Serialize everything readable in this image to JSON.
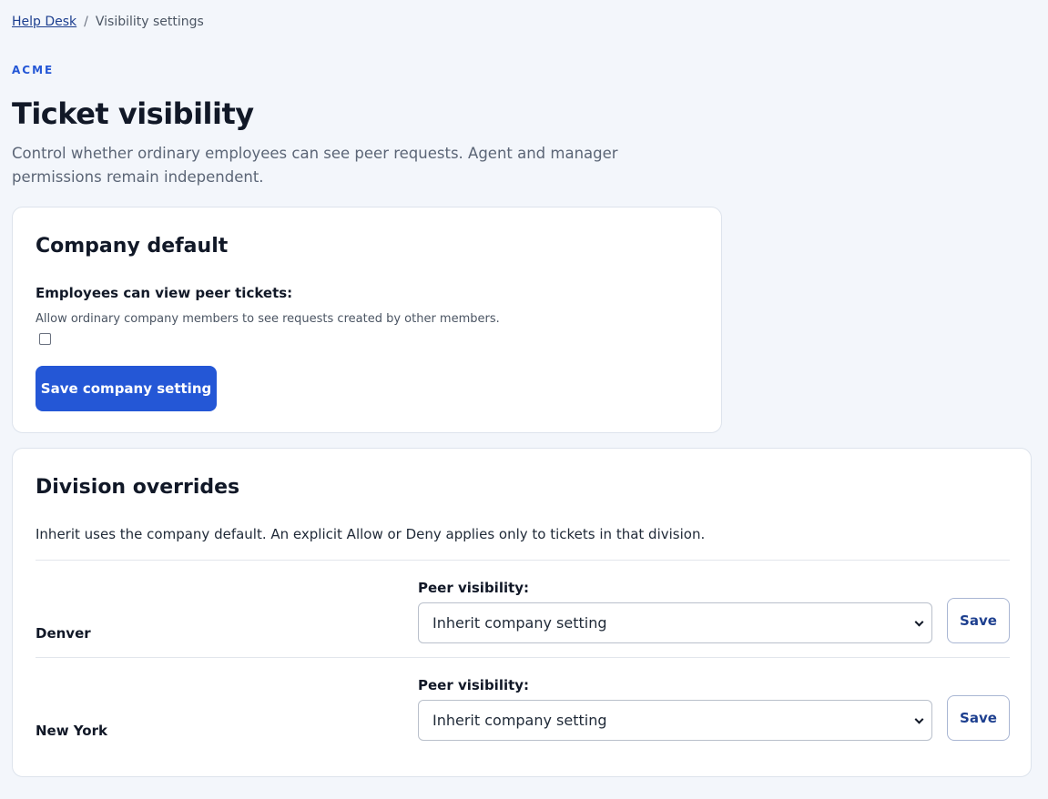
{
  "breadcrumb": {
    "home": "Help Desk",
    "separator": "/",
    "current": "Visibility settings"
  },
  "org_label": "ACME",
  "page": {
    "title": "Ticket visibility",
    "description": "Control whether ordinary employees can see peer requests. Agent and manager permissions remain independent."
  },
  "company_default": {
    "title": "Company default",
    "field_label": "Employees can view peer tickets:",
    "field_help": "Allow ordinary company members to see requests created by other members.",
    "checked": false,
    "save_label": "Save company setting"
  },
  "division_overrides": {
    "title": "Division overrides",
    "description": "Inherit uses the company default. An explicit Allow or Deny applies only to tickets in that division.",
    "rows": [
      {
        "name": "Denver",
        "field_label": "Peer visibility:",
        "selected": "Inherit company setting",
        "save_label": "Save"
      },
      {
        "name": "New York",
        "field_label": "Peer visibility:",
        "selected": "Inherit company setting",
        "save_label": "Save"
      }
    ]
  },
  "colors": {
    "accent": "#2457d6",
    "background": "#f3f6fb",
    "link": "#1d3f8f"
  }
}
